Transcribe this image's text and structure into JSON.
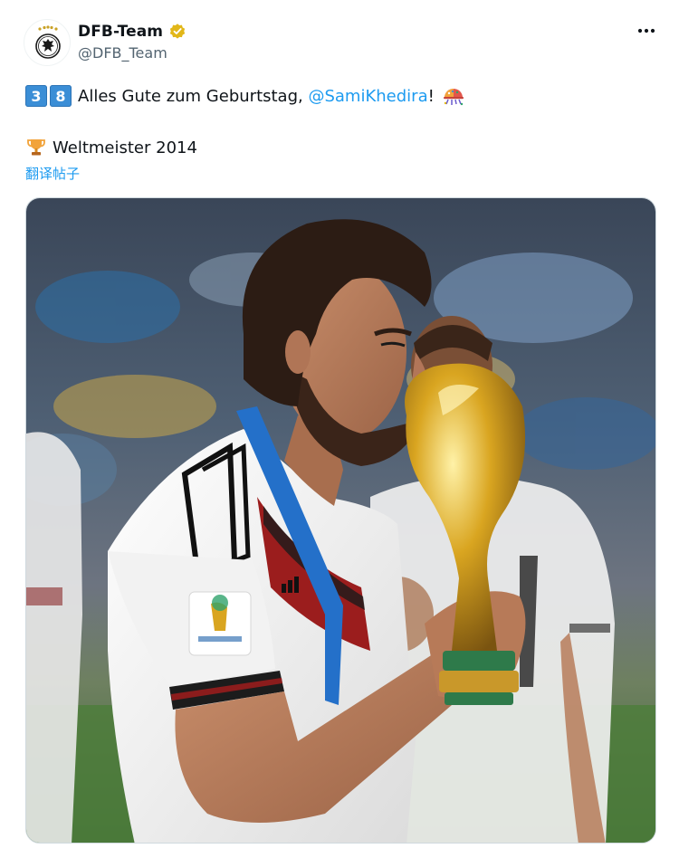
{
  "author": {
    "display_name": "DFB-Team",
    "handle": "@DFB_Team",
    "verified": true,
    "avatar_icon": "dfb-eagle-crest-icon"
  },
  "tweet": {
    "keycap_digits": [
      "3",
      "8"
    ],
    "text_part1": "Alles Gute zum Geburtstag, ",
    "mention": "@SamiKhedira",
    "text_part2": "!",
    "line2_text": "Weltmeister 2014",
    "translate_label": "翻译帖子",
    "emoji_icons": [
      "keycap-3-icon",
      "keycap-8-icon",
      "confetti-ball-icon",
      "trophy-icon"
    ]
  },
  "media": {
    "type": "photo",
    "alt": ""
  },
  "colors": {
    "link": "#1d9bf0",
    "text": "#0f1419",
    "secondary": "#536471",
    "verified_gold": "#e2b719",
    "keycap_blue": "#3b8ed6"
  }
}
